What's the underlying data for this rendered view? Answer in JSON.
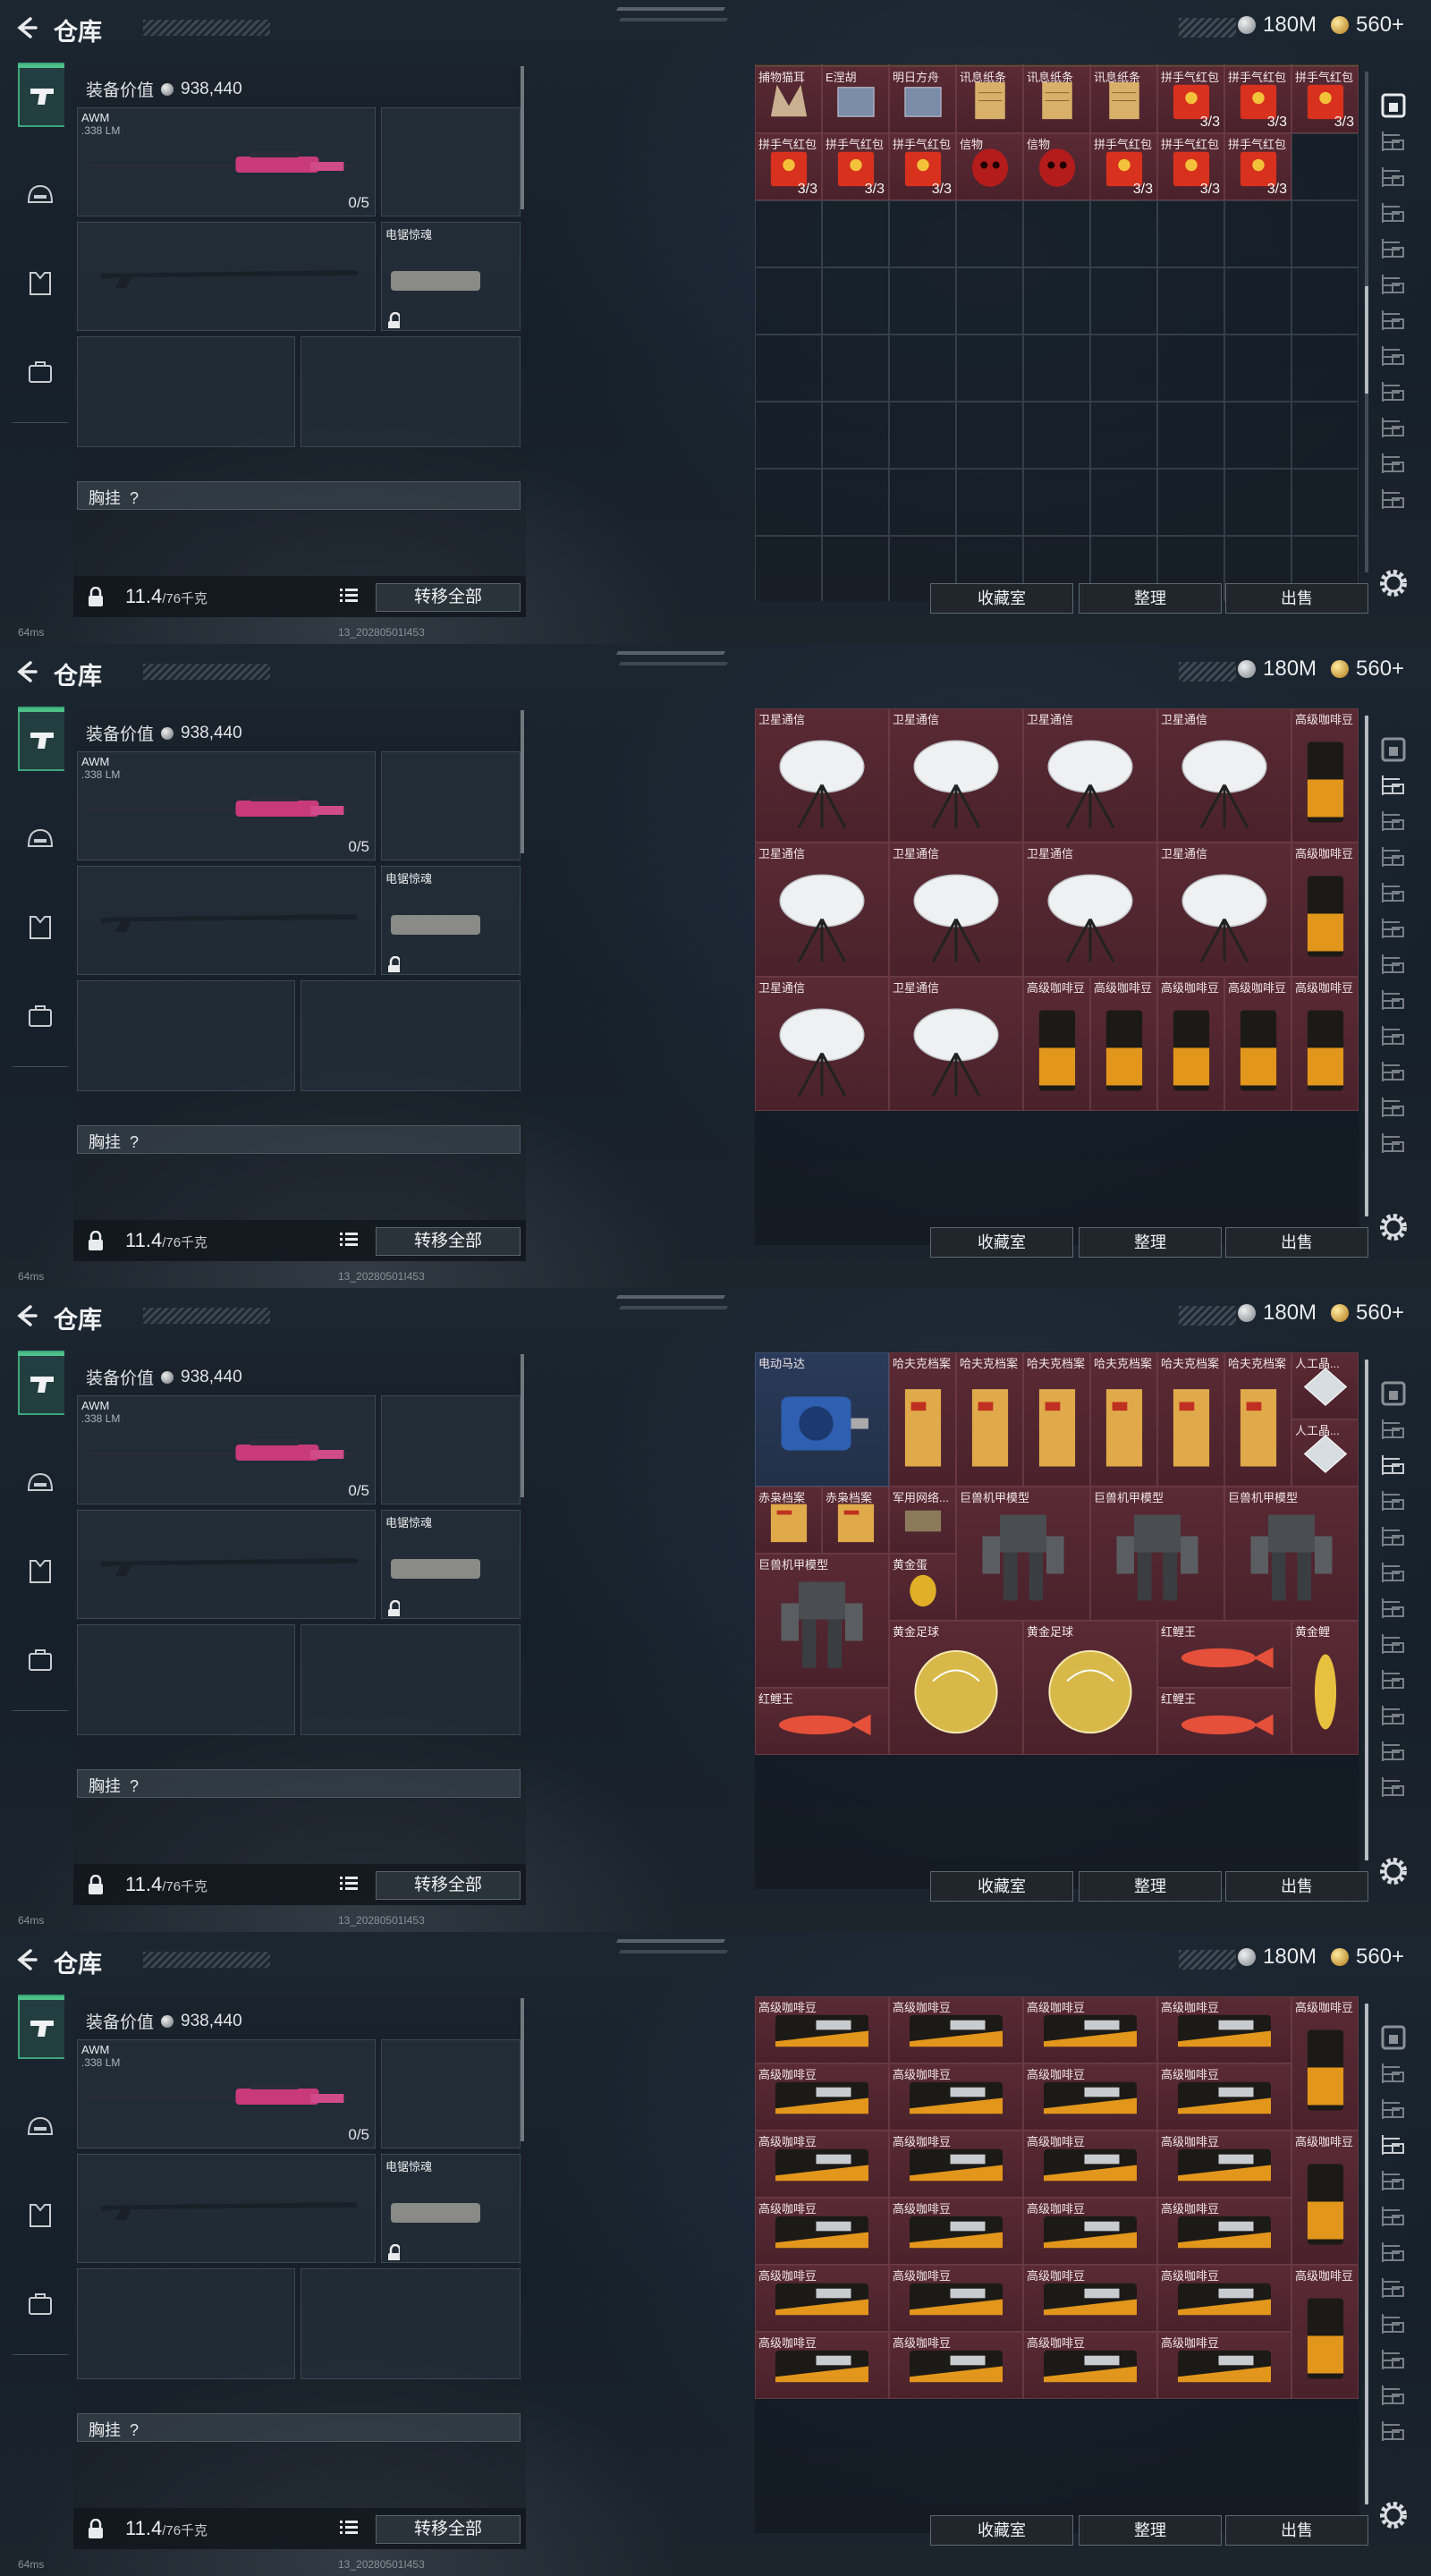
{
  "header": {
    "title": "仓库",
    "currency_silver": "180M",
    "currency_gold": "560+"
  },
  "equipment": {
    "value_label": "装备价值",
    "value": "938,440",
    "primary_weapon": {
      "name": "AWM",
      "ammo": ".338 LM",
      "count": "0/5"
    },
    "melee_label": "电锯惊魂",
    "chest_label": "胸挂",
    "chest_hint": "?",
    "weight_current": "11.4",
    "weight_max": "/76千克",
    "transfer_all_label": "转移全部"
  },
  "actions": {
    "collection_label": "收藏室",
    "organize_label": "整理",
    "sell_label": "出售"
  },
  "footer": {
    "ping": "64ms",
    "build": "13_20280501I453"
  },
  "panels": [
    {
      "rows": [
        [
          "捕物猫耳",
          "E涅胡",
          "明日方舟",
          "讯息纸条",
          "讯息纸条",
          "讯息纸条",
          "拼手气红包",
          "拼手气红包",
          "拼手气红包"
        ],
        [
          "拼手气红包",
          "拼手气红包",
          "拼手气红包",
          "信物",
          "信物",
          "拼手气红包",
          "拼手气红包",
          "拼手气红包",
          ""
        ]
      ],
      "qty": [
        [
          "",
          "",
          "",
          "",
          "",
          "",
          "3/3",
          "3/3",
          "3/3"
        ],
        [
          "3/3",
          "3/3",
          "3/3",
          "",
          "",
          "3/3",
          "3/3",
          "3/3",
          ""
        ]
      ]
    },
    {
      "rows": [
        [
          "卫星通信",
          "卫星通信",
          "卫星通信",
          "卫星通信",
          "高级咖啡豆"
        ],
        [
          "卫星通信",
          "卫星通信",
          "卫星通信",
          "卫星通信",
          "高级咖啡豆"
        ],
        [
          "卫星通信",
          "卫星通信",
          "高级咖啡豆",
          "高级咖啡豆",
          "高级咖啡豆",
          "高级咖啡豆",
          "高级咖啡豆"
        ]
      ]
    },
    {
      "items": [
        "电动马达",
        "哈夫克档案",
        "哈夫克档案",
        "哈夫克档案",
        "哈夫克档案",
        "哈夫克档案",
        "哈夫克档案",
        "人工晶...",
        "人工晶...",
        "赤枭档案",
        "赤枭档案",
        "军用网络...",
        "巨兽机甲模型",
        "巨兽机甲模型",
        "巨兽机甲模型",
        "巨兽机甲模型",
        "黄金蛋",
        "黄金足球",
        "黄金足球",
        "红鲤王",
        "黄金鲤",
        "红鲤王",
        "红鲤王"
      ]
    },
    {
      "label": "高级咖啡豆"
    }
  ]
}
